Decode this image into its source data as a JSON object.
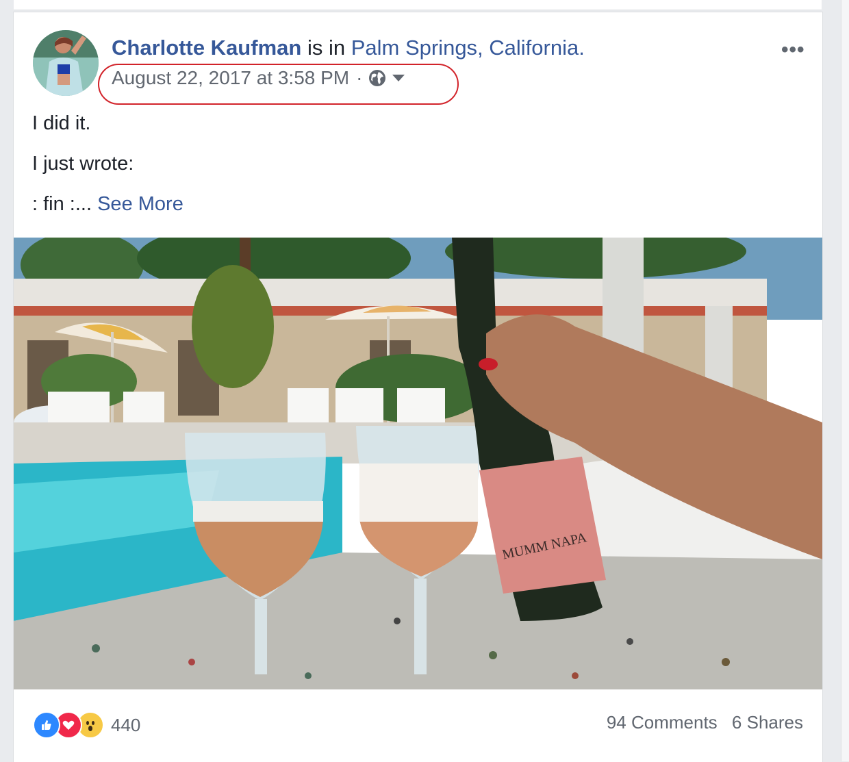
{
  "post": {
    "author": "Charlotte Kaufman",
    "status_connector": "is in",
    "location": "Palm Springs, California.",
    "timestamp": "August 22, 2017 at 3:58 PM",
    "separator": "·",
    "privacy_icon": "globe-icon",
    "more_icon": "•••",
    "body": {
      "line1": "I did it.",
      "line2": "I just wrote:",
      "line3": ": fin :...",
      "see_more": "See More"
    },
    "photo": {
      "bottle_label": "MUMM NAPA"
    },
    "reactions": {
      "types": [
        "like-icon",
        "love-icon",
        "wow-icon"
      ],
      "count": "440"
    },
    "stats": {
      "comments": "94 Comments",
      "shares": "6 Shares"
    }
  },
  "colors": {
    "link": "#365899",
    "text": "#1d2129",
    "meta": "#616770",
    "highlight_ring": "#d2232a"
  }
}
